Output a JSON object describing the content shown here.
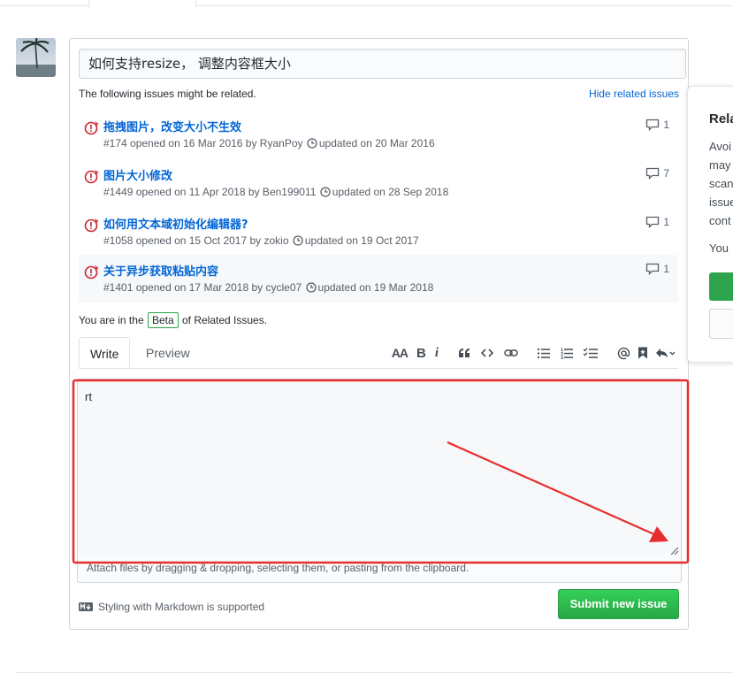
{
  "issue_title": "如何支持resize， 调整内容框大小",
  "related": {
    "note": "The following issues might be related.",
    "hide_label": "Hide related issues",
    "issues": [
      {
        "title": "拖拽图片，改变大小不生效",
        "opened": "#174 opened on 16 Mar 2016 by RyanPoy",
        "updated": "updated on 20 Mar 2016",
        "comments": "1"
      },
      {
        "title": "图片大小修改",
        "opened": "#1449 opened on 11 Apr 2018 by Ben199011",
        "updated": "updated on 28 Sep 2018",
        "comments": "7"
      },
      {
        "title": "如何用文本域初始化编辑器?",
        "opened": "#1058 opened on 15 Oct 2017 by zokio",
        "updated": "updated on 19 Oct 2017",
        "comments": "1"
      },
      {
        "title": "关于异步获取粘贴内容",
        "opened": "#1401 opened on 17 Mar 2018 by cycle07",
        "updated": "updated on 19 Mar 2018",
        "comments": "1"
      }
    ],
    "beta_prefix": "You are in the",
    "beta_badge": "Beta",
    "beta_suffix": "of Related Issues."
  },
  "tabs": {
    "write": "Write",
    "preview": "Preview"
  },
  "toolbar": {
    "heading": "AA",
    "bold": "B",
    "italic": "i"
  },
  "editor": {
    "body": "rt",
    "attach_hint": "Attach files by dragging & dropping, selecting them, or pasting from the clipboard."
  },
  "footer": {
    "markdown_note": "Styling with Markdown is supported",
    "submit_label": "Submit new issue"
  },
  "side_card": {
    "heading": "Rela",
    "lines": [
      "Avoi",
      "may",
      "scan",
      "issue",
      "cont"
    ],
    "line2": "You"
  },
  "colors": {
    "link": "#0366d6",
    "open_issue": "#cb2431",
    "submit": "#28a745",
    "annotation": "#e62e2e"
  }
}
